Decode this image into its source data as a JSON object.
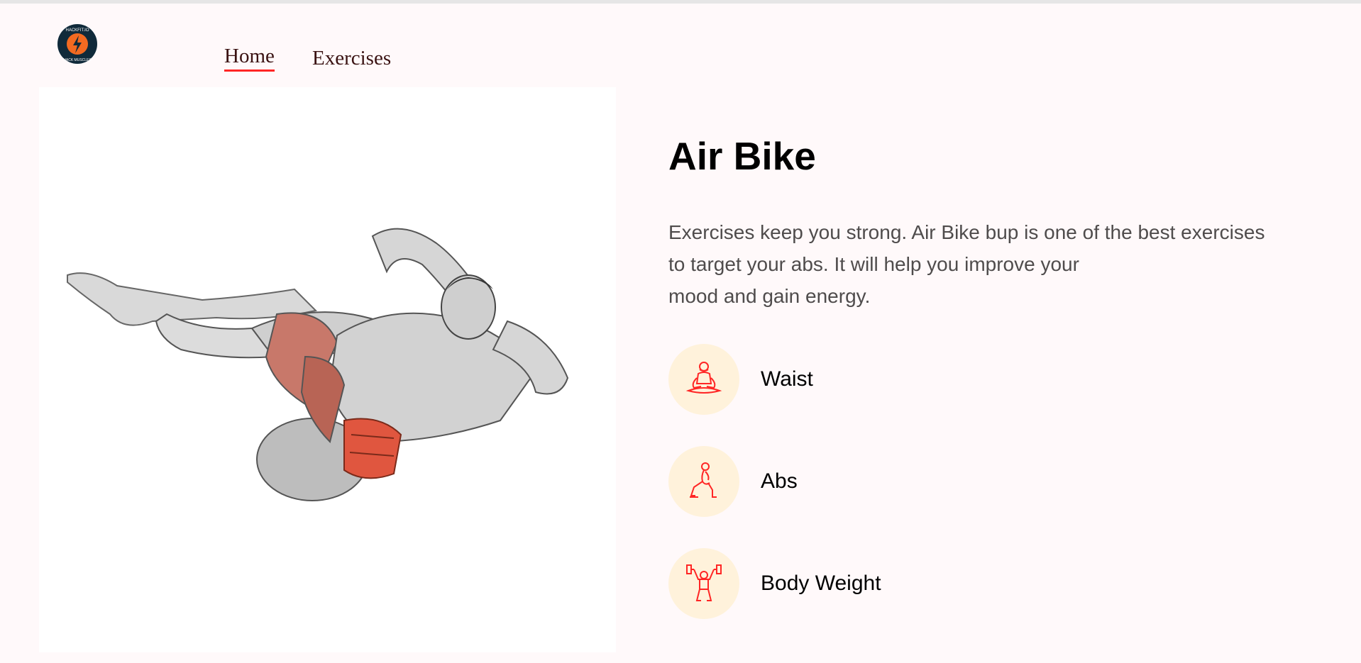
{
  "brand": {
    "logo_icon": "hackfit-logo-icon",
    "logo_top_text": "HACKFIT.IO",
    "logo_bottom_text": "HACK MUSCLES",
    "accent_color": "#ff2625"
  },
  "nav": {
    "home_label": "Home",
    "exercises_label": "Exercises"
  },
  "exercise": {
    "image_icon": "air-bike-illustration",
    "name": "Air Bike",
    "description_lines": [
      "Exercises keep you strong. Air Bike bup is one of the best exercises",
      "to target your abs. It will help you improve your",
      "mood and gain energy."
    ],
    "tags": [
      {
        "label": "Waist",
        "icon": "meditation-icon"
      },
      {
        "label": "Abs",
        "icon": "lunge-icon"
      },
      {
        "label": "Body Weight",
        "icon": "dumbbell-lift-icon"
      }
    ]
  },
  "colors": {
    "background": "#fff9fa",
    "tag_circle": "#fff2db",
    "icon_stroke": "#ff2625"
  }
}
